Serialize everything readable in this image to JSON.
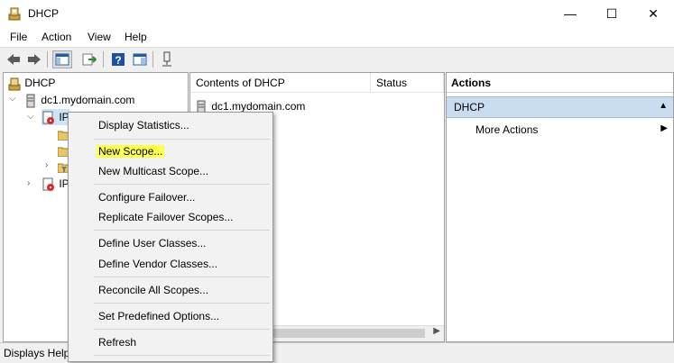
{
  "window": {
    "title": "DHCP",
    "minimize_glyph": "—",
    "maximize_glyph": "☐",
    "close_glyph": "✕"
  },
  "menu": [
    "File",
    "Action",
    "View",
    "Help"
  ],
  "toolbar": {
    "icons": [
      "back-icon",
      "forward-icon",
      "show-hide-tree-icon",
      "export-list-icon",
      "help-icon",
      "properties-icon",
      "audit-icon"
    ]
  },
  "tree": {
    "root": "DHCP",
    "server": "dc1.mydomain.com",
    "ipv4_visible": "IP",
    "ipv6_visible": "IP"
  },
  "contents": {
    "columns": [
      "Contents of DHCP",
      "Status"
    ],
    "rows": [
      "dc1.mydomain.com"
    ]
  },
  "actions": {
    "header": "Actions",
    "section": "DHCP",
    "items": [
      "More Actions"
    ]
  },
  "context_menu": {
    "items": [
      "Display Statistics...",
      "New Scope...",
      "New Multicast Scope...",
      "Configure Failover...",
      "Replicate Failover Scopes...",
      "Define User Classes...",
      "Define Vendor Classes...",
      "Reconcile All Scopes...",
      "Set Predefined Options...",
      "Refresh"
    ],
    "highlighted": "New Scope...",
    "highlight_color": "#ffff4d"
  },
  "status": {
    "text": "Displays Help"
  }
}
